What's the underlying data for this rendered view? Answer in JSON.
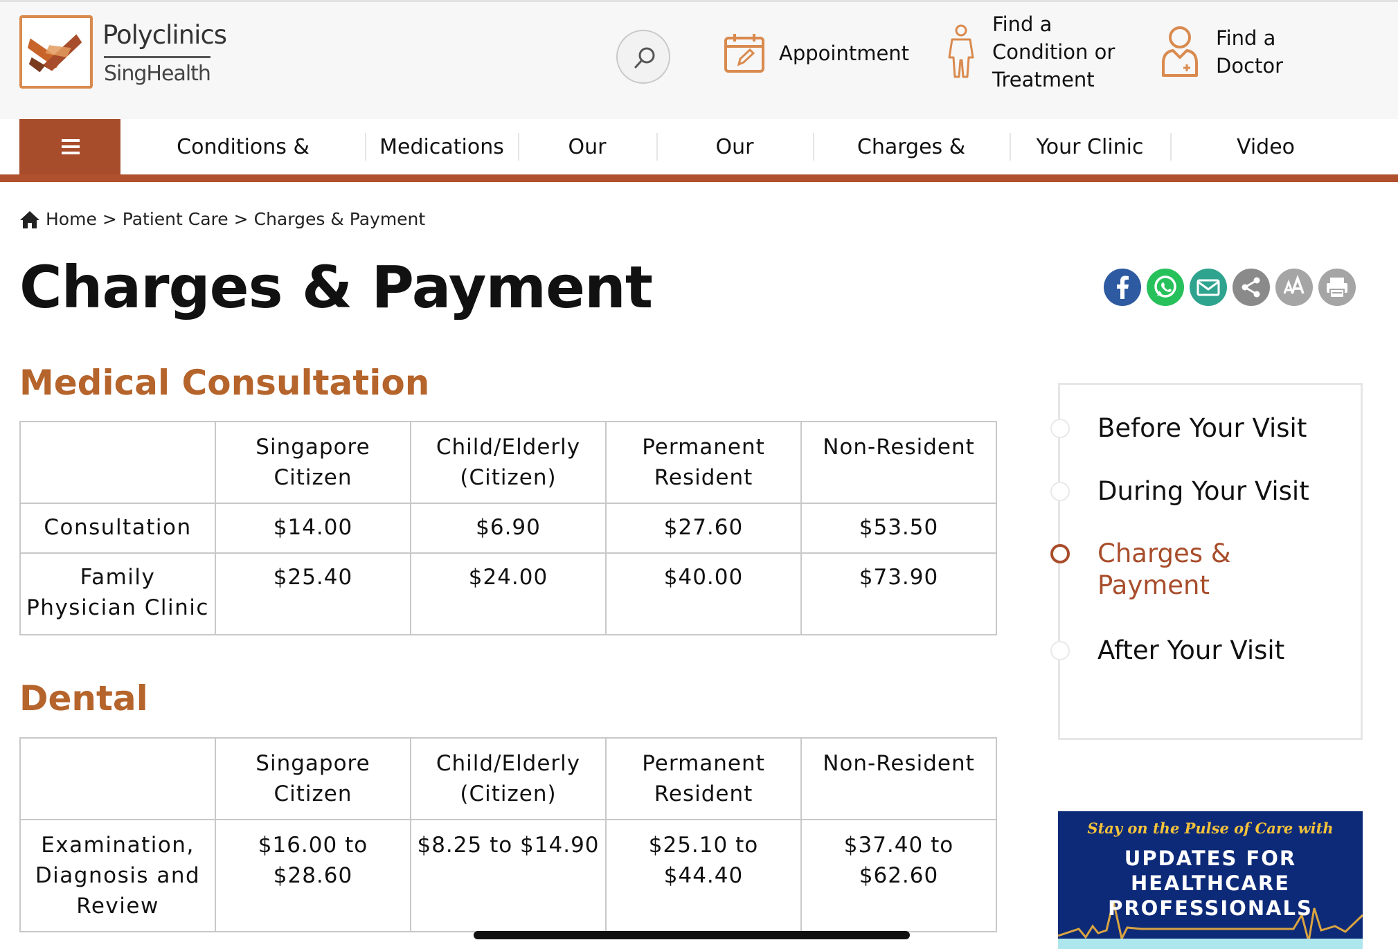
{
  "header": {
    "logo": {
      "line1": "Polyclinics",
      "line2": "SingHealth",
      "icon": "singhealth-logo-icon"
    },
    "search_icon": "search-icon",
    "utilities": {
      "appointment": {
        "label": "Appointment",
        "icon": "calendar-edit-icon"
      },
      "condition": {
        "label_lines": [
          "Find a",
          "Condition or",
          "Treatment"
        ],
        "icon": "person-icon"
      },
      "doctor": {
        "label_lines": [
          "Find a",
          "Doctor"
        ],
        "icon": "doctor-icon"
      }
    }
  },
  "nav": {
    "menu_icon": "hamburger-menu-icon",
    "items": [
      "Conditions &",
      "Medications",
      "Our",
      "Our",
      "Charges &",
      "Your Clinic",
      "Video"
    ]
  },
  "breadcrumb": {
    "home_icon": "home-icon",
    "items": [
      "Home",
      "Patient Care",
      "Charges & Payment"
    ],
    "separator": ">"
  },
  "page_title": "Charges & Payment",
  "share_buttons": [
    "facebook-icon",
    "whatsapp-icon",
    "email-icon",
    "share-icon",
    "font-size-icon",
    "print-icon"
  ],
  "sections": [
    {
      "title": "Medical Consultation",
      "headers": [
        "",
        "Singapore Citizen",
        "Child/Elderly (Citizen)",
        "Permanent Resident",
        "Non-Resident"
      ],
      "rows": [
        [
          "Consultation",
          "$14.00",
          "$6.90",
          "$27.60",
          "$53.50"
        ],
        [
          "Family Physician Clinic",
          "$25.40",
          "$24.00",
          "$40.00",
          "$73.90"
        ]
      ]
    },
    {
      "title": "Dental",
      "headers": [
        "",
        "Singapore Citizen",
        "Child/Elderly (Citizen)",
        "Permanent Resident",
        "Non-Resident"
      ],
      "rows": [
        [
          "Examination, Diagnosis and Review",
          "$16.00 to $28.60",
          "$8.25 to $14.90",
          "$25.10 to $44.40",
          "$37.40 to $62.60"
        ]
      ]
    }
  ],
  "side_nav": {
    "items": [
      "Before Your Visit",
      "During Your Visit",
      "Charges & Payment",
      "After Your Visit"
    ],
    "active_index": 2
  },
  "banner": {
    "tagline": "Stay on the Pulse of Care with",
    "headline_lines": [
      "UPDATES FOR",
      "HEALTHCARE",
      "PROFESSIONALS"
    ]
  },
  "colors": {
    "brand_orange": "#b5642b",
    "nav_rust": "#a84d2b",
    "banner_navy": "#0d2a79"
  }
}
